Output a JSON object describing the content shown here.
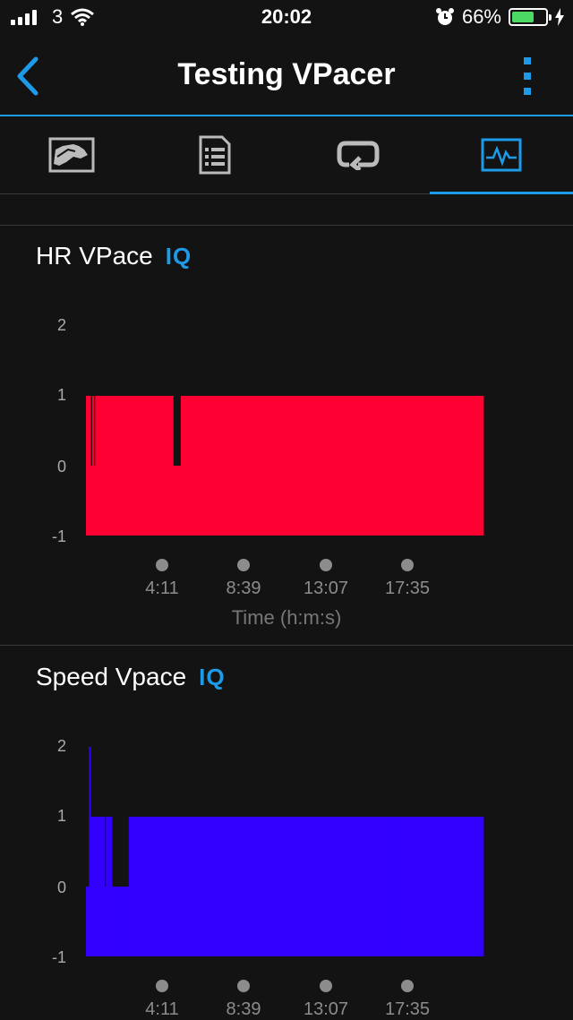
{
  "status_bar": {
    "carrier": "3",
    "time": "20:02",
    "battery": "66%",
    "battery_level": 0.66
  },
  "nav": {
    "title": "Testing VPacer"
  },
  "tabs": [
    {
      "name": "overview",
      "icon": "map-icon",
      "active": false
    },
    {
      "name": "details",
      "icon": "document-list-icon",
      "active": false
    },
    {
      "name": "laps",
      "icon": "loop-icon",
      "active": false
    },
    {
      "name": "charts",
      "icon": "activity-chart-icon",
      "active": true
    }
  ],
  "colors": {
    "accent": "#1e9be8",
    "hr_series": "#ff0033",
    "speed_series": "#3300ff",
    "background": "#131313"
  },
  "chart_data": [
    {
      "type": "area",
      "title": "HR VPace",
      "badge": "IQ",
      "color": "#ff0033",
      "xlabel": "Time (h:m:s)",
      "ylabel": "",
      "ylim": [
        -1,
        2
      ],
      "yticks": [
        "2",
        "1",
        "0",
        "-1"
      ],
      "xticks": [
        "4:11",
        "8:39",
        "13:07",
        "17:35"
      ],
      "xrange": [
        0,
        1300
      ],
      "x": [
        0,
        10,
        15,
        20,
        25,
        30,
        35,
        40,
        45,
        50,
        55,
        60,
        65,
        70,
        75,
        80,
        85,
        90,
        95,
        100,
        105,
        110,
        115,
        120,
        125,
        130,
        135,
        140,
        145,
        150,
        155,
        160,
        165,
        170,
        175,
        180,
        185,
        190,
        195,
        200,
        205,
        210,
        215,
        220,
        225,
        230,
        235,
        240,
        245,
        250,
        255,
        260,
        265,
        270,
        275,
        280,
        285,
        290,
        295,
        300,
        305,
        310,
        315,
        320,
        325,
        330,
        335,
        340,
        345,
        350,
        355,
        360,
        365,
        370,
        375,
        380,
        385,
        390,
        395,
        400,
        405,
        410,
        415,
        420,
        425,
        430,
        435,
        440,
        445,
        450,
        455,
        460,
        465,
        470,
        475,
        480,
        485,
        490,
        495,
        500,
        505,
        510,
        515,
        520,
        525,
        530,
        535,
        540,
        545,
        550,
        555,
        560,
        565,
        570,
        575,
        580,
        585,
        590,
        595,
        600,
        605,
        610,
        615,
        620,
        625,
        630,
        635,
        640,
        645,
        650,
        655,
        660,
        665,
        670,
        675,
        680,
        685,
        690,
        695,
        700,
        705,
        710,
        715,
        720,
        725,
        730,
        735,
        740,
        745,
        750,
        755,
        760,
        765,
        770,
        775,
        780,
        785,
        790,
        795,
        800,
        805,
        810,
        815,
        820,
        825,
        830,
        835,
        840,
        845,
        850,
        855,
        860,
        865,
        870,
        875,
        880,
        885,
        890,
        895,
        900,
        905,
        910,
        915,
        920,
        925,
        930,
        935,
        940,
        945,
        950,
        955,
        960,
        965,
        970,
        975,
        980,
        985,
        990,
        995,
        1000,
        1005,
        1010,
        1015,
        1020,
        1025,
        1030,
        1035,
        1040,
        1045,
        1050,
        1055,
        1060,
        1065,
        1070,
        1075,
        1080,
        1085,
        1090,
        1095,
        1100,
        1105,
        1110,
        1115,
        1120,
        1125,
        1130,
        1135,
        1140,
        1145,
        1150,
        1155,
        1160,
        1165,
        1170,
        1175,
        1180,
        1185,
        1190,
        1195,
        1200,
        1205,
        1210,
        1215,
        1220,
        1225,
        1230,
        1235,
        1240,
        1245,
        1250,
        1255,
        1260,
        1265,
        1270,
        1275,
        1280,
        1285,
        1290,
        1295,
        1300
      ],
      "values": [
        1,
        1,
        0,
        1,
        0,
        1,
        1,
        1,
        1,
        1,
        1,
        1,
        1,
        1,
        1,
        1,
        1,
        1,
        1,
        1,
        1,
        1,
        1,
        1,
        1,
        1,
        1,
        1,
        1,
        1,
        1,
        1,
        1,
        1,
        1,
        1,
        1,
        1,
        1,
        1,
        1,
        1,
        1,
        1,
        1,
        1,
        1,
        1,
        1,
        1,
        1,
        1,
        1,
        1,
        1,
        1,
        0,
        0,
        0,
        0,
        0,
        1,
        1,
        1,
        1,
        1,
        1,
        1,
        1,
        1,
        1,
        1,
        1,
        1,
        1,
        1,
        1,
        1,
        1,
        1,
        1,
        1,
        1,
        1,
        1,
        1,
        1,
        1,
        1,
        1,
        1,
        1,
        1,
        1,
        1,
        1,
        1,
        1,
        1,
        1,
        1,
        1,
        1,
        1,
        1,
        1,
        1,
        1,
        1,
        1,
        1,
        1,
        1,
        1,
        1,
        1,
        1,
        1,
        1,
        1,
        1,
        1,
        1,
        1,
        1,
        1,
        1,
        1,
        1,
        1,
        1,
        1,
        1,
        1,
        1,
        1,
        1,
        1,
        1,
        1,
        1,
        1,
        1,
        1,
        1,
        1,
        1,
        1,
        1,
        1,
        1,
        1,
        1,
        1,
        1,
        1,
        1,
        1,
        1,
        1,
        1,
        1,
        1,
        1,
        1,
        1,
        1,
        1,
        1,
        1,
        1,
        1,
        1,
        1,
        1,
        1,
        1,
        1,
        1,
        1,
        1,
        1,
        1,
        1,
        1,
        1,
        1,
        1,
        1,
        1,
        1,
        1,
        1,
        1,
        1,
        1,
        1,
        1,
        1,
        1,
        1,
        1,
        1,
        1,
        1,
        1,
        1,
        1,
        1,
        1,
        1,
        1,
        1,
        1,
        1,
        1,
        1,
        1,
        1,
        1,
        1,
        1,
        1,
        1,
        1,
        1,
        1,
        1,
        1,
        1,
        1,
        1,
        1,
        1,
        1,
        1,
        1,
        1,
        1,
        1,
        1,
        1,
        1,
        1,
        1,
        1,
        1,
        1,
        1,
        1,
        1,
        1,
        1,
        1,
        1,
        1,
        1,
        1,
        1,
        1,
        1,
        1,
        1,
        1,
        1,
        1,
        1,
        1,
        1,
        1,
        1,
        1,
        1,
        1,
        1,
        1,
        1,
        1
      ]
    },
    {
      "type": "area",
      "title": "Speed Vpace",
      "badge": "IQ",
      "color": "#3300ff",
      "xlabel": "",
      "ylabel": "",
      "ylim": [
        -1,
        2
      ],
      "yticks": [
        "2",
        "1",
        "0",
        "-1"
      ],
      "xticks": [
        "4:11",
        "8:39",
        "13:07",
        "17:35"
      ],
      "xrange": [
        0,
        1300
      ],
      "x": [
        0,
        10,
        15,
        20,
        25,
        30,
        35,
        40,
        45,
        50,
        55,
        60,
        65,
        70,
        75,
        80,
        85,
        90,
        95,
        100,
        105,
        110,
        115,
        120,
        125,
        130,
        135,
        140,
        145,
        150,
        155,
        160,
        165,
        170,
        175,
        180,
        185,
        190,
        195,
        200,
        205,
        210,
        215,
        220,
        225,
        230,
        235,
        240,
        245,
        250,
        255,
        260,
        265,
        270,
        275,
        280,
        285,
        290,
        295,
        300,
        305,
        310,
        315,
        320,
        325,
        330,
        335,
        340,
        345,
        350,
        355,
        360,
        365,
        370,
        375,
        380,
        385,
        390,
        395,
        400,
        405,
        410,
        415,
        420,
        425,
        430,
        435,
        440,
        445,
        450,
        455,
        460,
        465,
        470,
        475,
        480,
        485,
        490,
        495,
        500,
        505,
        510,
        515,
        520,
        525,
        530,
        535,
        540,
        545,
        550,
        555,
        560,
        565,
        570,
        575,
        580,
        585,
        590,
        595,
        600,
        605,
        610,
        615,
        620,
        625,
        630,
        635,
        640,
        645,
        650,
        655,
        660,
        665,
        670,
        675,
        680,
        685,
        690,
        695,
        700,
        705,
        710,
        715,
        720,
        725,
        730,
        735,
        740,
        745,
        750,
        755,
        760,
        765,
        770,
        775,
        780,
        785,
        790,
        795,
        800,
        805,
        810,
        815,
        820,
        825,
        830,
        835,
        840,
        845,
        850,
        855,
        860,
        865,
        870,
        875,
        880,
        885,
        890,
        895,
        900,
        905,
        910,
        915,
        920,
        925,
        930,
        935,
        940,
        945,
        950,
        955,
        960,
        965,
        970,
        975,
        980,
        985,
        990,
        995,
        1000,
        1005,
        1010,
        1015,
        1020,
        1025,
        1030,
        1035,
        1040,
        1045,
        1050,
        1055,
        1060,
        1065,
        1070,
        1075,
        1080,
        1085,
        1090,
        1095,
        1100,
        1105,
        1110,
        1115,
        1120,
        1125,
        1130,
        1135,
        1140,
        1145,
        1150,
        1155,
        1160,
        1165,
        1170,
        1175,
        1180,
        1185,
        1190,
        1195,
        1200,
        1205,
        1210,
        1215,
        1220,
        1225,
        1230,
        1235,
        1240,
        1245,
        1250,
        1255,
        1260,
        1265,
        1270,
        1275,
        1280,
        1285,
        1290,
        1295,
        1300
      ],
      "values": [
        0,
        2,
        1,
        1,
        1,
        1,
        1,
        1,
        1,
        1,
        1,
        0,
        1,
        1,
        1,
        1,
        0,
        0,
        0,
        0,
        0,
        0,
        0,
        0,
        0,
        0,
        0,
        1,
        1,
        1,
        1,
        1,
        1,
        1,
        1,
        1,
        1,
        1,
        1,
        1,
        1,
        1,
        1,
        1,
        1,
        1,
        1,
        1,
        1,
        1,
        1,
        1,
        1,
        1,
        1,
        1,
        1,
        1,
        1,
        1,
        1,
        1,
        1,
        1,
        1,
        1,
        1,
        1,
        1,
        1,
        1,
        1,
        1,
        1,
        1,
        1,
        1,
        1,
        1,
        1,
        1,
        1,
        1,
        1,
        1,
        1,
        1,
        1,
        1,
        1,
        1,
        1,
        1,
        1,
        1,
        1,
        1,
        1,
        1,
        1,
        1,
        1,
        1,
        1,
        1,
        1,
        1,
        1,
        1,
        1,
        1,
        1,
        1,
        1,
        1,
        1,
        1,
        1,
        1,
        1,
        1,
        1,
        1,
        1,
        1,
        1,
        1,
        1,
        1,
        1,
        1,
        1,
        1,
        1,
        1,
        1,
        1,
        1,
        1,
        1,
        1,
        1,
        1,
        1,
        1,
        1,
        1,
        1,
        1,
        1,
        1,
        1,
        1,
        1,
        1,
        1,
        1,
        1,
        1,
        1,
        1,
        1,
        1,
        1,
        1,
        1,
        1,
        1,
        1,
        1,
        1,
        1,
        1,
        1,
        1,
        1,
        1,
        1,
        1,
        1,
        1,
        1,
        1,
        1,
        1,
        1,
        1,
        1,
        1,
        1,
        1,
        1,
        1,
        1,
        1,
        1,
        1,
        1,
        1,
        1,
        1,
        1,
        1,
        1,
        1,
        1,
        1,
        1,
        1,
        1,
        1,
        1,
        1,
        1,
        1,
        1,
        1,
        1,
        1,
        1,
        1,
        1,
        1,
        1,
        1,
        1,
        1,
        1,
        1,
        1,
        1,
        1,
        1,
        1,
        1,
        1,
        1,
        1,
        1,
        1,
        1,
        1,
        1,
        1,
        1,
        1,
        1,
        1,
        1,
        1,
        1,
        1,
        1,
        1,
        1,
        1,
        1,
        1,
        1,
        1,
        1,
        1,
        1,
        1,
        1,
        1,
        1,
        1,
        1,
        1,
        1,
        1,
        1,
        1,
        1
      ]
    }
  ]
}
